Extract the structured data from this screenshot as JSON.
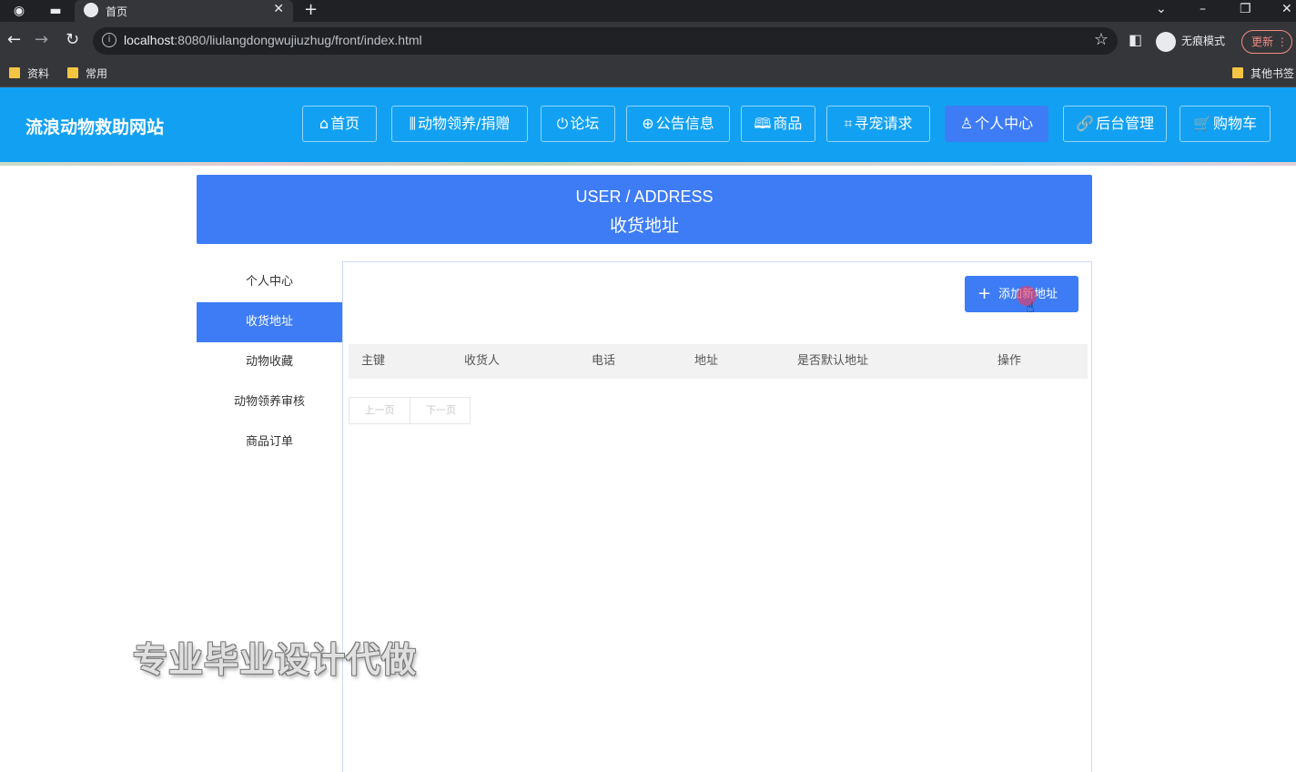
{
  "browser": {
    "tab_title": "首页",
    "url_host": "localhost",
    "url_rest": ":8080/liulangdongwujiuzhug/front/index.html",
    "incognito_label": "无痕模式",
    "update_label": "更新",
    "bookmarks": [
      "资料",
      "常用"
    ],
    "other_bookmarks": "其他书签"
  },
  "site": {
    "title": "流浪动物救助网站",
    "nav": [
      {
        "icon": "⌂",
        "label": "首页"
      },
      {
        "icon": "⫼",
        "label": "动物领养/捐赠"
      },
      {
        "icon": "⏻",
        "label": "论坛"
      },
      {
        "icon": "⊕",
        "label": "公告信息"
      },
      {
        "icon": "🕮",
        "label": "商品"
      },
      {
        "icon": "⌗",
        "label": "寻宠请求"
      },
      {
        "icon": "♙",
        "label": "个人中心"
      },
      {
        "icon": "🔗",
        "label": "后台管理"
      },
      {
        "icon": "🛒",
        "label": "购物车"
      }
    ],
    "active_nav": "个人中心"
  },
  "banner": {
    "en": "USER / ADDRESS",
    "zh": "收货地址"
  },
  "side_menu": [
    {
      "label": "个人中心",
      "active": false
    },
    {
      "label": "收货地址",
      "active": true
    },
    {
      "label": "动物收藏",
      "active": false
    },
    {
      "label": "动物领养审核",
      "active": false
    },
    {
      "label": "商品订单",
      "active": false
    }
  ],
  "panel": {
    "add_button": "添加新地址",
    "columns": [
      "主键",
      "收货人",
      "电话",
      "地址",
      "是否默认地址",
      "操作"
    ],
    "pager": {
      "prev": "上一页",
      "next": "下一页"
    }
  },
  "watermark": "专业毕业设计代做",
  "colors": {
    "header": "#12a1f2",
    "accent": "#3d7cf5"
  }
}
